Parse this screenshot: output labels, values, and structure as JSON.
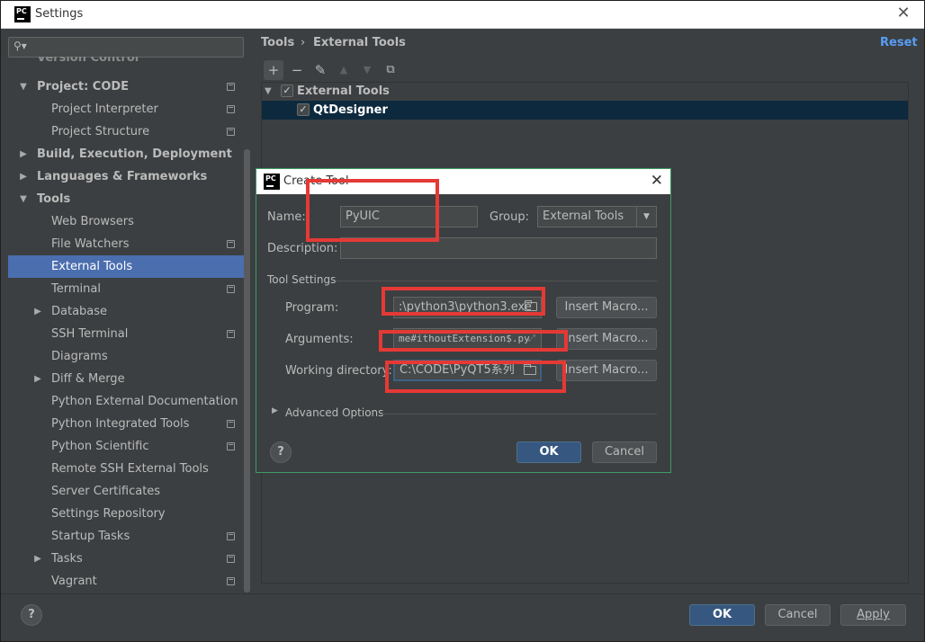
{
  "window": {
    "title": "Settings"
  },
  "sidebar": {
    "search_placeholder": "",
    "cut_item": "Version Control",
    "items": [
      {
        "label": "Project: CODE",
        "bold": true,
        "expanded": true
      },
      {
        "label": "Project Interpreter"
      },
      {
        "label": "Project Structure"
      },
      {
        "label": "Build, Execution, Deployment",
        "bold": true
      },
      {
        "label": "Languages & Frameworks",
        "bold": true
      },
      {
        "label": "Tools",
        "bold": true,
        "expanded": true
      },
      {
        "label": "Web Browsers"
      },
      {
        "label": "File Watchers"
      },
      {
        "label": "External Tools",
        "selected": true
      },
      {
        "label": "Terminal"
      },
      {
        "label": "Database"
      },
      {
        "label": "SSH Terminal"
      },
      {
        "label": "Diagrams"
      },
      {
        "label": "Diff & Merge"
      },
      {
        "label": "Python External Documentation"
      },
      {
        "label": "Python Integrated Tools"
      },
      {
        "label": "Python Scientific"
      },
      {
        "label": "Remote SSH External Tools"
      },
      {
        "label": "Server Certificates"
      },
      {
        "label": "Settings Repository"
      },
      {
        "label": "Startup Tasks"
      },
      {
        "label": "Tasks"
      },
      {
        "label": "Vagrant"
      }
    ]
  },
  "main": {
    "breadcrumb": [
      "Tools",
      "External Tools"
    ],
    "breadcrumb_sep": "›",
    "reset": "Reset",
    "tree": {
      "group": "External Tools",
      "tool": "QtDesigner"
    }
  },
  "dialog": {
    "title": "Create Tool",
    "name_label": "Name:",
    "name_value": "PyUIC",
    "group_label": "Group:",
    "group_value": "External Tools",
    "description_label": "Description:",
    "description_value": "",
    "tool_settings": "Tool Settings",
    "program_label": "Program:",
    "program_value": ":\\python3\\python3.exe",
    "arguments_label": "Arguments:",
    "arguments_value": "me#ithoutExtension$.py",
    "workdir_label": "Working directory:",
    "workdir_value": "C:\\CODE\\PyQT5系列",
    "insert_macro": "Insert Macro...",
    "advanced": "Advanced Options",
    "ok": "OK",
    "cancel": "Cancel",
    "help": "?"
  },
  "footer": {
    "help": "?",
    "ok": "OK",
    "cancel": "Cancel",
    "apply": "Apply"
  },
  "colors": {
    "selection": "#4b6eaf",
    "link": "#589df6",
    "primary_button": "#365880",
    "annotation": "#e53935",
    "dialog_border": "#3d9b64"
  }
}
